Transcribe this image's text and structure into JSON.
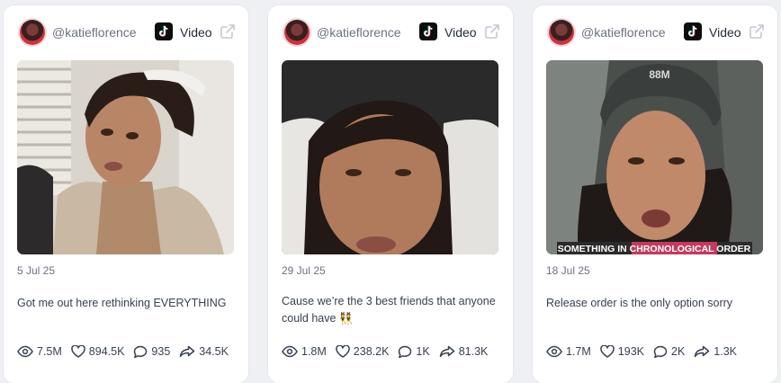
{
  "cards": [
    {
      "username": "@katieflorence",
      "type_label": "Video",
      "date": "5 Jul 25",
      "caption": "Got me out here rethinking EVERYTHING",
      "stats": {
        "views": "7.5M",
        "likes": "894.5K",
        "comments": "935",
        "shares": "34.5K"
      }
    },
    {
      "username": "@katieflorence",
      "type_label": "Video",
      "date": "29 Jul 25",
      "caption": "Cause we’re the 3 best friends that anyone could have 👯",
      "stats": {
        "views": "1.8M",
        "likes": "238.2K",
        "comments": "1K",
        "shares": "81.3K"
      }
    },
    {
      "username": "@katieflorence",
      "type_label": "Video",
      "date": "18 Jul 25",
      "caption": "Release order is the only option sorry",
      "stats": {
        "views": "1.7M",
        "likes": "193K",
        "comments": "2K",
        "shares": "1.3K"
      }
    }
  ],
  "thumb_overlays": {
    "card3_beanie_text": "88M",
    "card3_banner_text": "SOMETHING IN CHRONOLOGICAL ORDER"
  },
  "icons": {
    "platform": "tiktok-icon",
    "open": "external-link-icon",
    "views": "eye-icon",
    "likes": "heart-icon",
    "comments": "comment-icon",
    "shares": "share-icon"
  }
}
